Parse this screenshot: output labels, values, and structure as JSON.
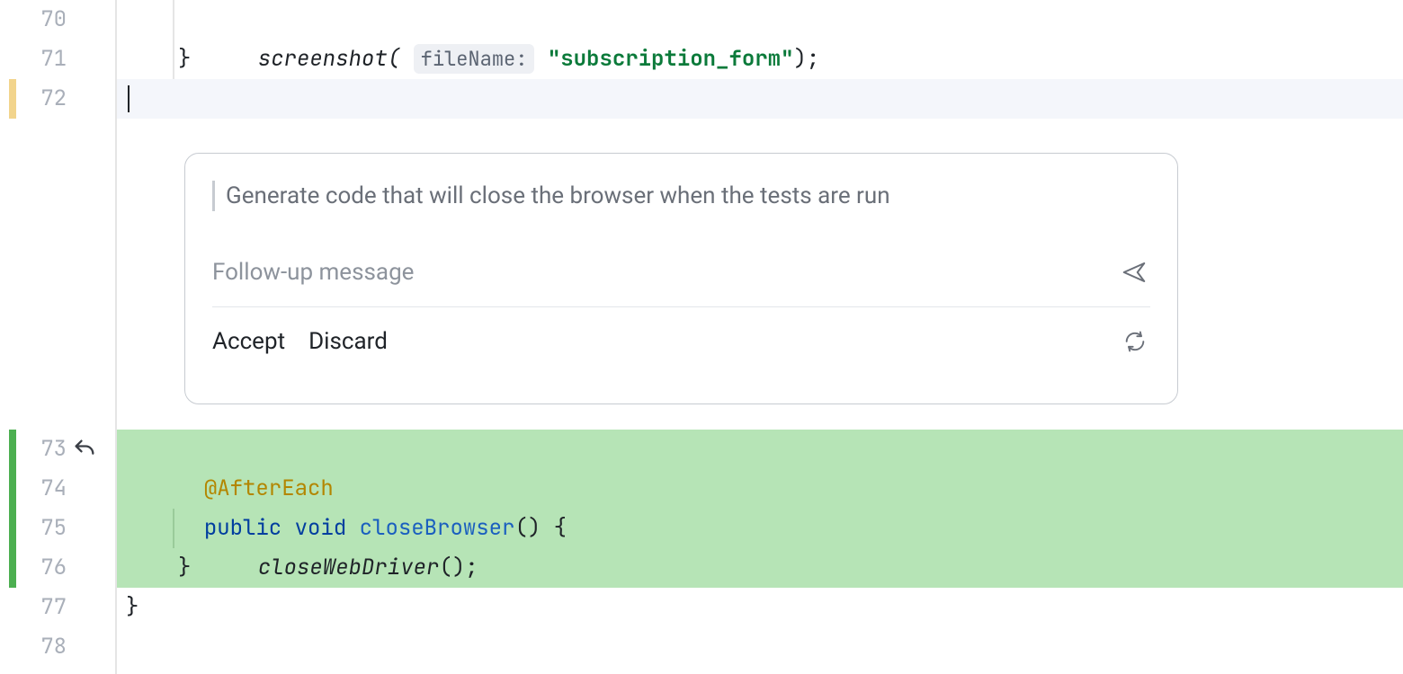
{
  "lines_top": [
    {
      "num": "70"
    },
    {
      "num": "71"
    },
    {
      "num": "72"
    }
  ],
  "lines_added": [
    {
      "num": "73"
    },
    {
      "num": "74"
    },
    {
      "num": "75"
    },
    {
      "num": "76"
    }
  ],
  "lines_bottom": [
    {
      "num": "77"
    },
    {
      "num": "78"
    }
  ],
  "code": {
    "l70": {
      "fn": "screenshot",
      "open": "(",
      "paramHint": "fileName:",
      "str_open": " \"",
      "str": "subscription_form",
      "str_close": "\"",
      "tail": ");"
    },
    "l71": {
      "brace": "}"
    },
    "l72": {
      "text": ""
    },
    "l73": {
      "annot": "@AfterEach"
    },
    "l74": {
      "kw1": "public",
      "sp1": " ",
      "kw2": "void",
      "sp2": " ",
      "mname": "closeBrowser",
      "tail": "() {"
    },
    "l75": {
      "fn": "closeWebDriver",
      "tail": "();"
    },
    "l76": {
      "brace": "}"
    },
    "l77": {
      "brace": "}"
    },
    "l78": {
      "text": ""
    }
  },
  "ai_panel": {
    "prev_prompt": "Generate code that will close the browser when the tests are run",
    "followup_placeholder": "Follow-up message",
    "accept": "Accept",
    "discard": "Discard"
  },
  "icons": {
    "undo": "undo-icon",
    "send": "send-icon",
    "refresh": "refresh-icon"
  }
}
